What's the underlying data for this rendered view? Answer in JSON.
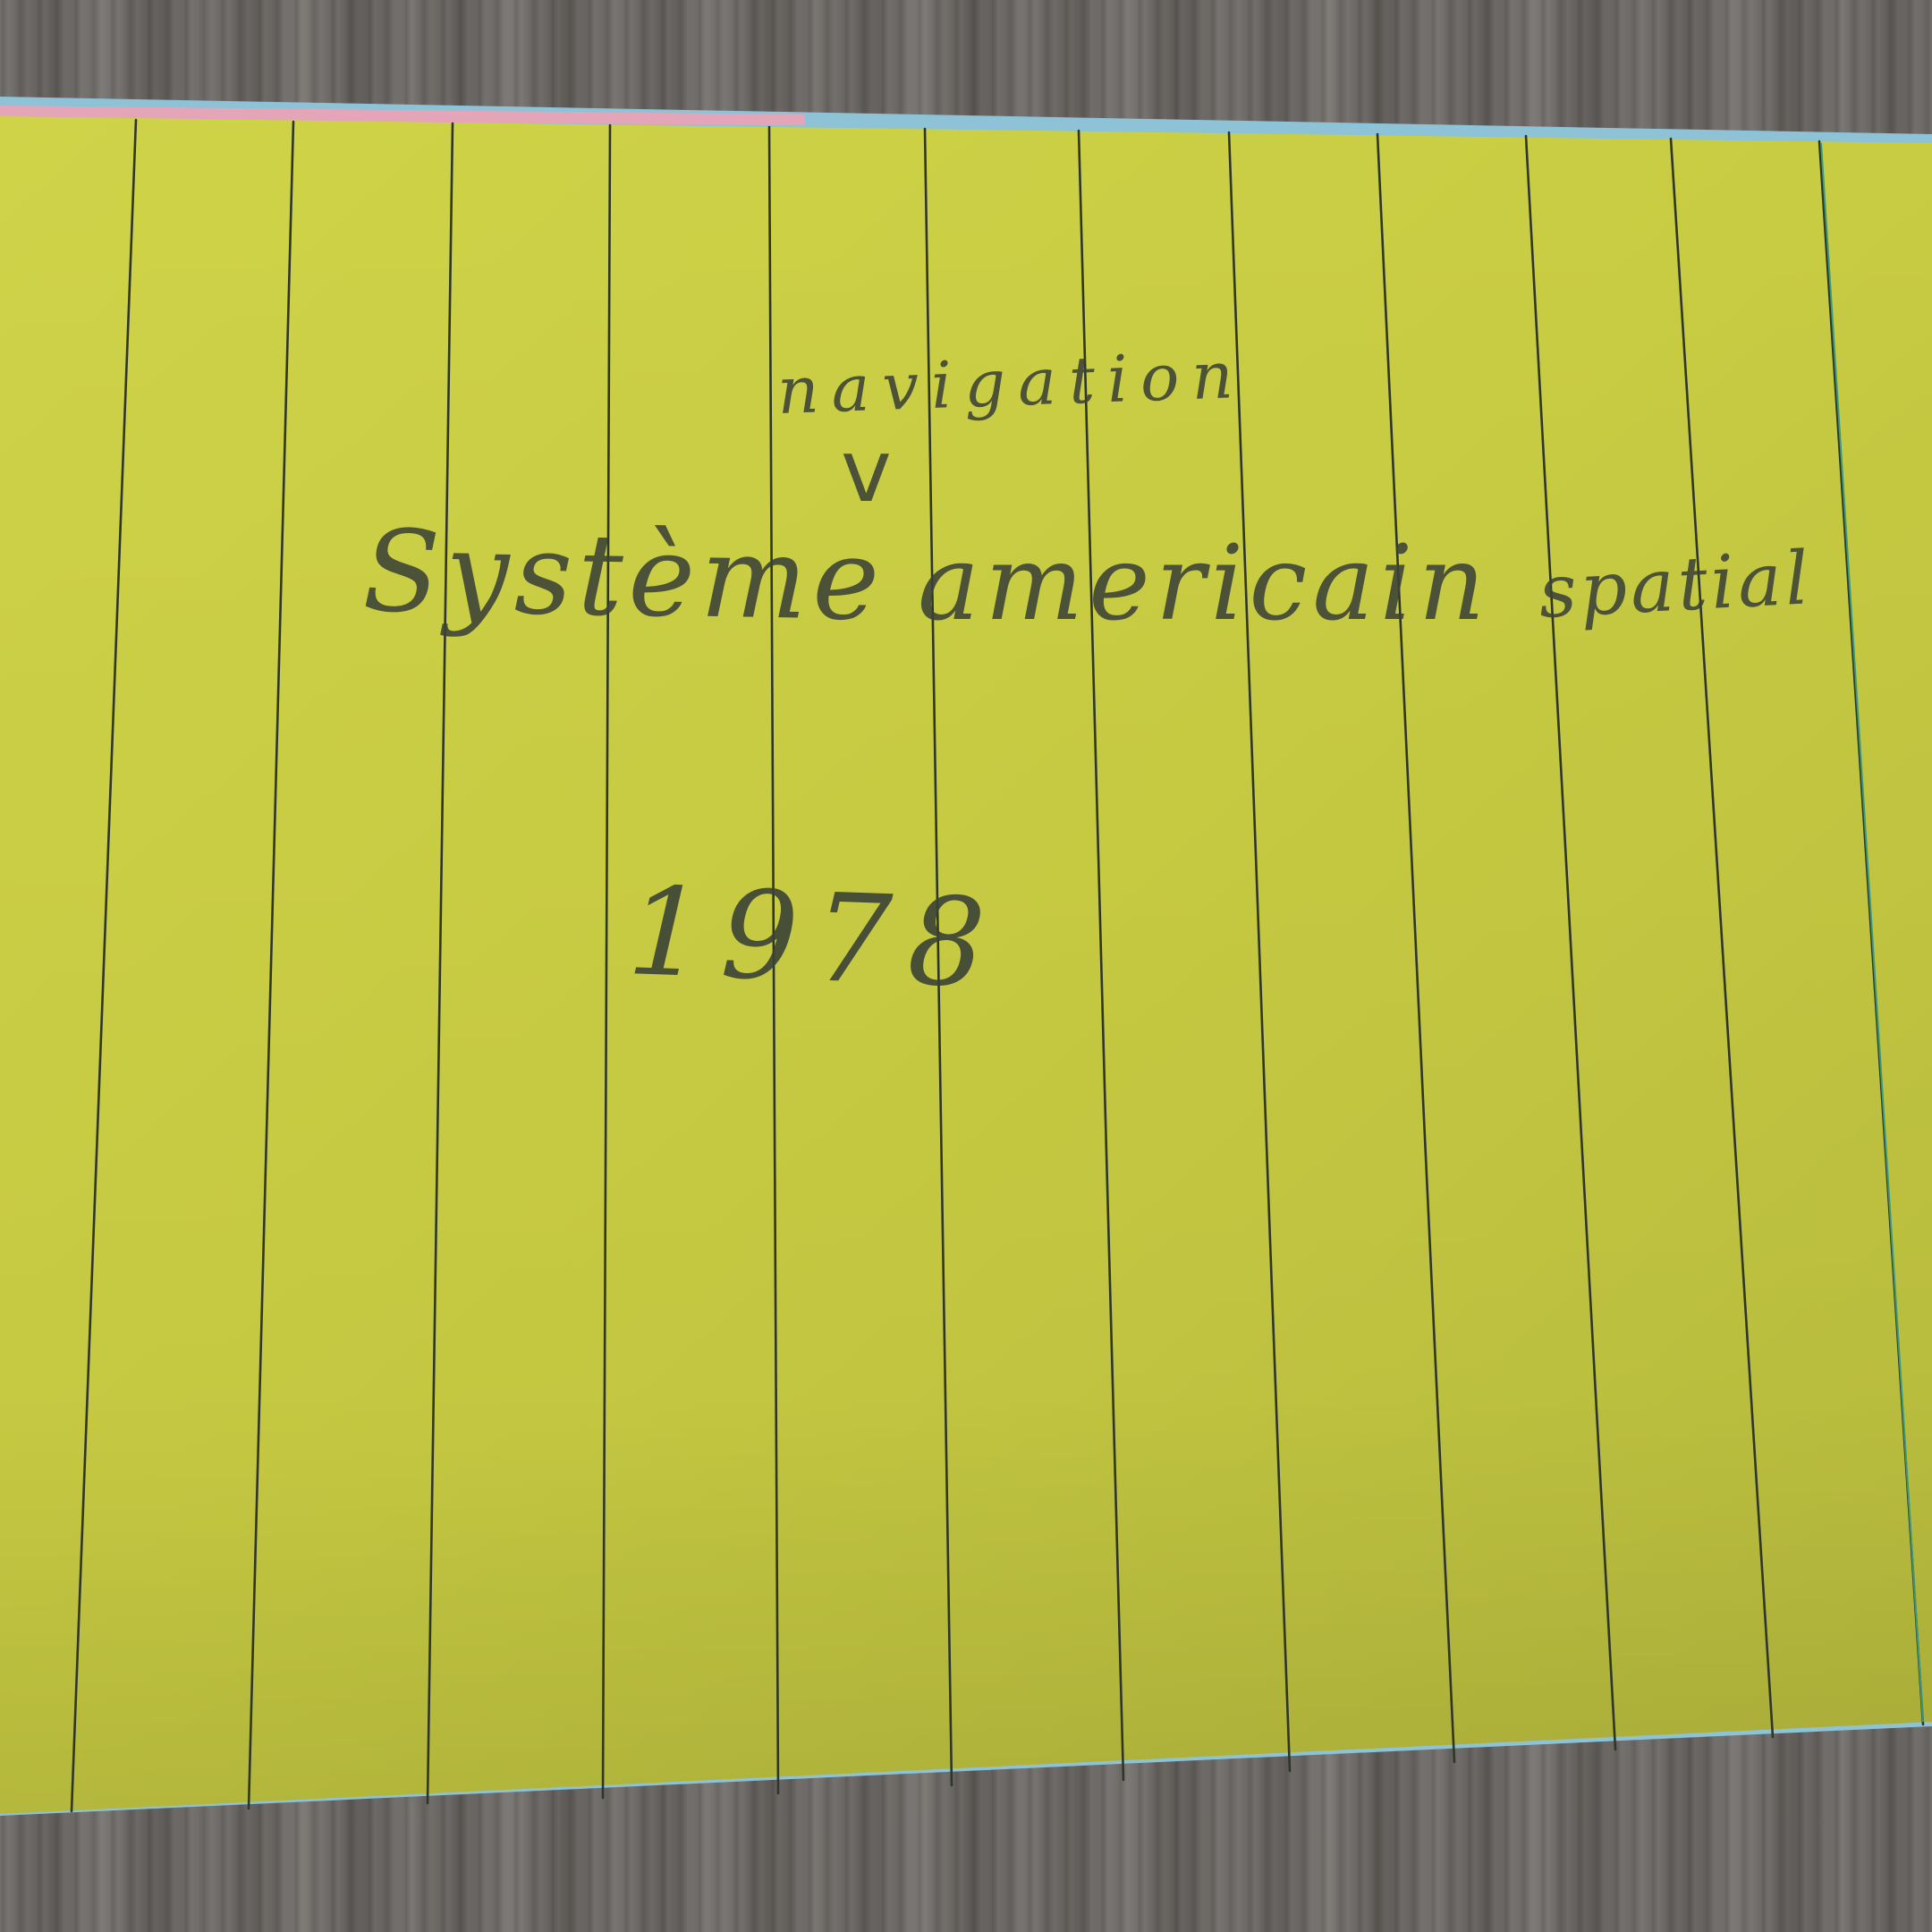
{
  "scene": {
    "description_tag": "",
    "card_color": "#c9cd45",
    "under_card_colors": [
      "#8fc4d8",
      "#e6a3b6"
    ],
    "rule_color": "#2e3a2a",
    "ink_color": "#3b4236"
  },
  "handwriting": {
    "insertion": "navigation",
    "caret": "v",
    "line1_word1": "Système",
    "line1_word2": "americain",
    "line1_word3": "spatial",
    "year": "1978"
  }
}
